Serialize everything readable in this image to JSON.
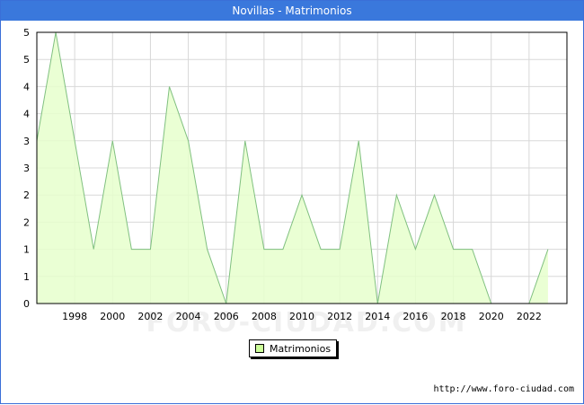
{
  "title": "Novillas - Matrimonios",
  "source_url": "http://www.foro-ciudad.com",
  "watermark": "FORO-CIUDAD.COM",
  "colors": {
    "title_bg": "#3a78dc",
    "area_fill": "#e6ffcc",
    "line": "#80c080",
    "grid": "#d8d8d8"
  },
  "chart_data": {
    "type": "area",
    "title": "Novillas - Matrimonios",
    "x": [
      1996,
      1997,
      1998,
      1999,
      2000,
      2001,
      2002,
      2003,
      2004,
      2005,
      2006,
      2007,
      2008,
      2009,
      2010,
      2011,
      2012,
      2013,
      2014,
      2015,
      2016,
      2017,
      2018,
      2019,
      2020,
      2021,
      2022,
      2023
    ],
    "series": [
      {
        "name": "Matrimonios",
        "values": [
          3,
          5,
          3,
          1,
          3,
          1,
          1,
          4,
          3,
          1,
          0,
          3,
          1,
          1,
          2,
          1,
          1,
          3,
          0,
          2,
          1,
          2,
          1,
          1,
          0,
          0,
          0,
          1
        ]
      }
    ],
    "xlim": [
      1996,
      2024
    ],
    "ylim": [
      0,
      5
    ],
    "x_ticks": [
      1998,
      2000,
      2002,
      2004,
      2006,
      2008,
      2010,
      2012,
      2014,
      2016,
      2018,
      2020,
      2022
    ],
    "y_tick_labels": [
      "0",
      "1",
      "1",
      "2",
      "2",
      "3",
      "3",
      "4",
      "4",
      "5",
      "5"
    ],
    "grid": true,
    "legend_position": "bottom-center"
  }
}
